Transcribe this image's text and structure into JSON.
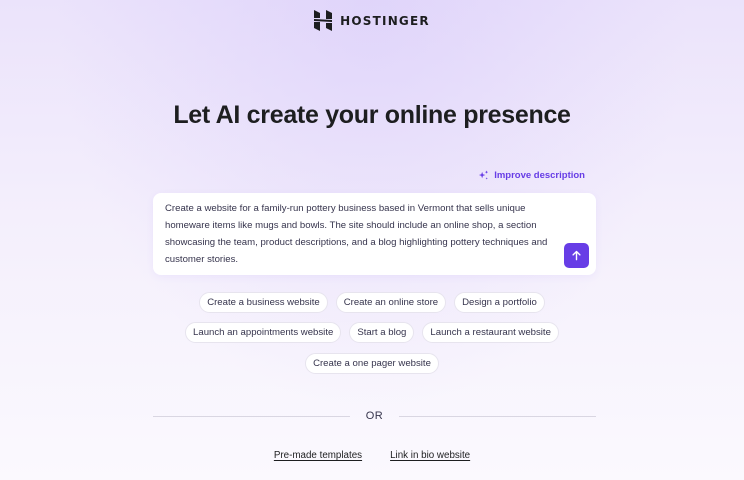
{
  "brand": {
    "name": "HOSTINGER",
    "logo_icon": "hostinger-logo-icon"
  },
  "hero": {
    "title": "Let AI create your online presence"
  },
  "improve": {
    "label": "Improve description",
    "icon": "sparkle-icon"
  },
  "prompt": {
    "text": "Create a website for a family-run pottery business based in Vermont that sells unique homeware items like mugs and bowls. The site should include an online shop, a section showcasing the team, product descriptions, and a blog highlighting pottery techniques and customer stories.",
    "submit_icon": "arrow-up-icon"
  },
  "suggestions": [
    [
      "Create a business website",
      "Create an online store",
      "Design a portfolio"
    ],
    [
      "Launch an appointments website",
      "Start a blog",
      "Launch a restaurant website"
    ],
    [
      "Create a one pager website"
    ]
  ],
  "divider": {
    "label": "OR"
  },
  "links": {
    "templates": "Pre-made templates",
    "link_in_bio": "Link in bio website"
  },
  "colors": {
    "accent": "#673de6",
    "text": "#1d1e20"
  }
}
